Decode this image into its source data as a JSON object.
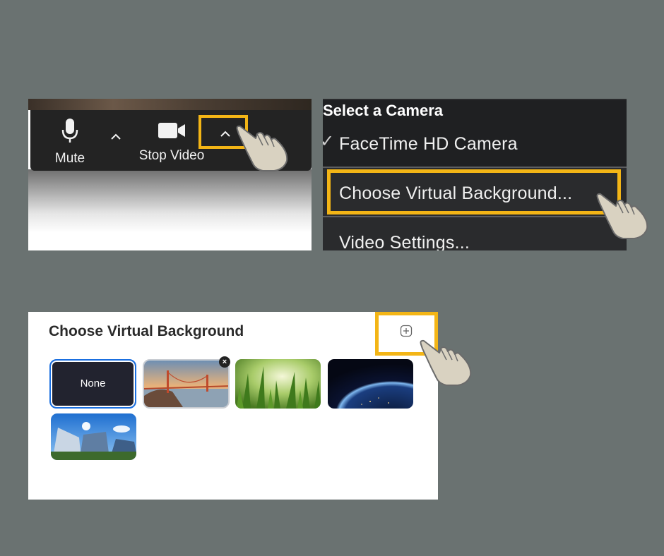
{
  "toolbar": {
    "mute_label": "Mute",
    "stop_video_label": "Stop Video",
    "icons": [
      "microphone-icon",
      "chevron-up-icon",
      "video-camera-icon",
      "chevron-up-icon"
    ]
  },
  "camera_menu": {
    "title": "Select a Camera",
    "check_mark": "✓",
    "items": [
      "FaceTime HD Camera",
      "Choose Virtual Background...",
      "Video Settings..."
    ]
  },
  "virtual_background": {
    "title": "Choose Virtual Background",
    "add_icon": "plus-square-icon",
    "thumbnails": [
      {
        "label": "None",
        "selected": true
      },
      {
        "image": "golden-gate-bridge"
      },
      {
        "image": "grass"
      },
      {
        "image": "earth-from-space"
      },
      {
        "image": "modern-building"
      }
    ],
    "remove_glyph": "×"
  },
  "colors": {
    "background": "#6a7271",
    "highlight": "#f3b516",
    "toolbar": "#232323",
    "menu": "#2a2b2d",
    "selection_border": "#1a6fe0"
  }
}
